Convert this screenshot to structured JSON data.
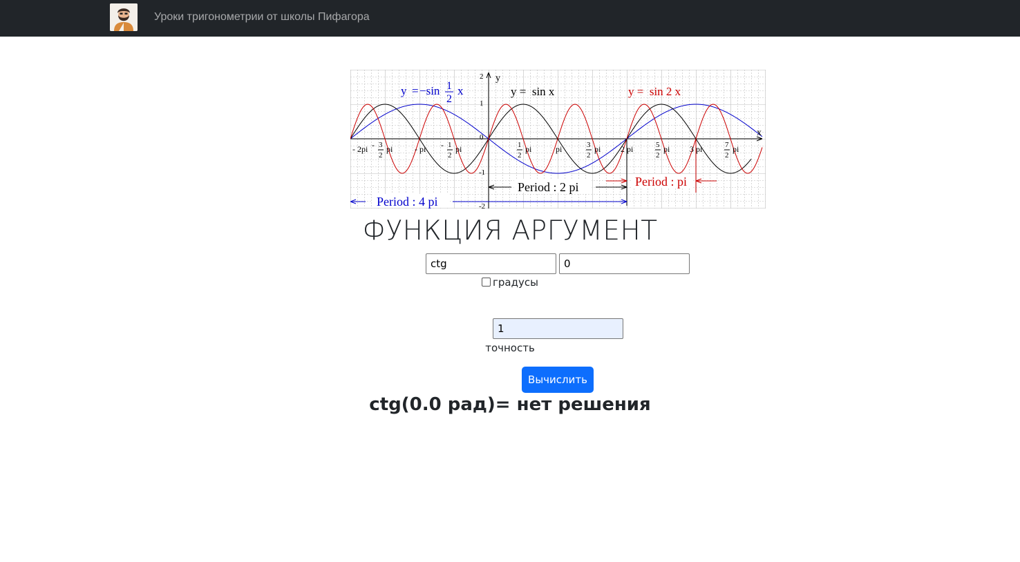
{
  "navbar": {
    "title": "Уроки тригонометрии от школы Пифагора",
    "logo_icon": "pythagoras-avatar-icon"
  },
  "graph": {
    "labels": {
      "eq_blue_y": "y",
      "eq_blue_eq": "=",
      "eq_blue_minus_sin": "−sin",
      "eq_blue_num": "1",
      "eq_blue_den": "2",
      "eq_blue_x": "x",
      "eq_black": "y =  sin x",
      "eq_red": "y =  sin 2 x",
      "axis_x": "x",
      "axis_y": "y",
      "tick_y_2": "2",
      "tick_y_1": "1",
      "tick_y_0": "0",
      "tick_y_m1": "-1",
      "tick_y_m2": "-2",
      "tick_m2pi": "- 2pi",
      "tick_m32_minus": "-",
      "tick_m32_num": "3",
      "tick_m32_den": "2",
      "tick_m32_pi": "pi",
      "tick_mpi": "- pi",
      "tick_m12_minus": "-",
      "tick_m12_num": "1",
      "tick_m12_den": "2",
      "tick_m12_pi": "pi",
      "tick_12_num": "1",
      "tick_12_den": "2",
      "tick_12_pi": "pi",
      "tick_pi": "pi",
      "tick_32_num": "3",
      "tick_32_den": "2",
      "tick_32_pi": "pi",
      "tick_2pi": "2 pi",
      "tick_52_num": "5",
      "tick_52_den": "2",
      "tick_52_pi": "pi",
      "tick_3pi": "3 pi",
      "tick_72_num": "7",
      "tick_72_den": "2",
      "tick_72_pi": "pi",
      "period_black": "Period : 2 pi",
      "period_red": "Period : pi",
      "period_blue": "Period : 4 pi"
    },
    "colors": {
      "sin_x": "#000000",
      "sin_2x": "#cc0000",
      "neg_sin_half_x": "#0000cc",
      "grid": "#bdbdbd"
    }
  },
  "heading": "ФУНКЦИЯ АРГУМЕНТ",
  "form": {
    "function_value": "ctg",
    "argument_value": "0",
    "degrees_label": "градусы",
    "degrees_checked": false,
    "precision_value": "1",
    "precision_label": "точность",
    "submit_label": "Вычислить"
  },
  "result": "ctg(0.0 рад)= нет решения"
}
